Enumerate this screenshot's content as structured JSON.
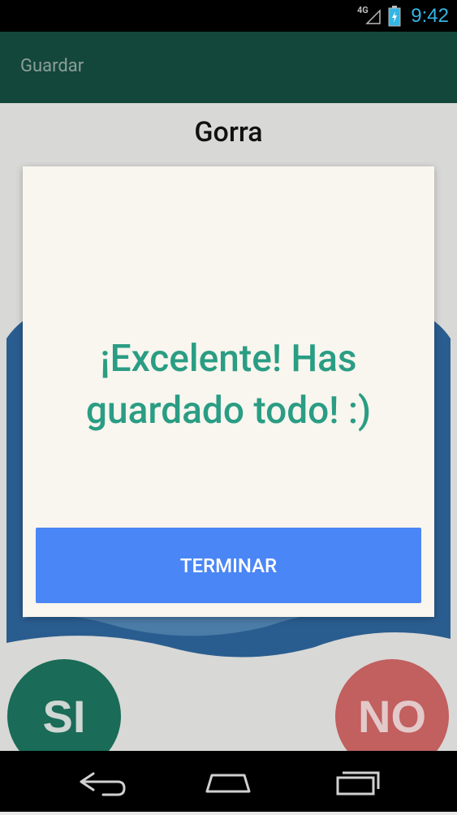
{
  "status_bar": {
    "time": "9:42",
    "network": "4G"
  },
  "app_bar": {
    "title": "Guardar"
  },
  "item": {
    "title": "Gorra"
  },
  "buttons": {
    "yes": "SI",
    "no": "NO"
  },
  "dialog": {
    "message": "¡Excelente! Has guardado todo! :)",
    "action": "TERMINAR"
  },
  "colors": {
    "app_bar": "#14473b",
    "accent_text": "#2a9d84",
    "dialog_button": "#4a86f5"
  },
  "nav_bar": {
    "icons": [
      "back-icon",
      "home-icon",
      "recent-apps-icon"
    ]
  }
}
